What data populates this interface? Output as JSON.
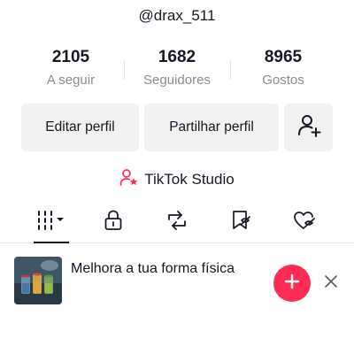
{
  "profile": {
    "username": "@drax_511",
    "stats": [
      {
        "value": "2105",
        "label": "A seguir"
      },
      {
        "value": "1682",
        "label": "Seguidores"
      },
      {
        "value": "8965",
        "label": "Gostos"
      }
    ]
  },
  "actions": {
    "edit_label": "Editar perfil",
    "share_label": "Partilhar perfil",
    "add_friend_icon": "add-user-icon"
  },
  "studio": {
    "label": "TikTok Studio",
    "icon": "studio-person-star-icon"
  },
  "tabs": [
    {
      "icon": "grid-videos-icon",
      "active": true
    },
    {
      "icon": "lock-icon",
      "active": false
    },
    {
      "icon": "repost-icon",
      "active": false
    },
    {
      "icon": "bookmark-icon",
      "active": false
    },
    {
      "icon": "liked-hidden-icon",
      "active": false
    }
  ],
  "suggestion": {
    "text": "Melhora a tua forma física",
    "add_icon": "plus-icon",
    "close_icon": "close-icon"
  },
  "colors": {
    "accent": "#fe2c55",
    "text": "#161823",
    "muted": "#8a8b91",
    "button_bg": "#f1f1f2"
  }
}
